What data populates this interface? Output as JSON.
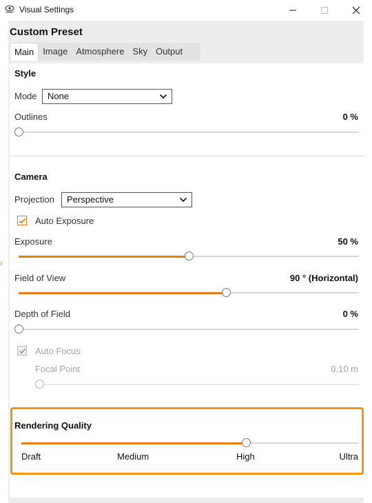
{
  "window": {
    "title": "Visual Settings"
  },
  "preset": {
    "title": "Custom Preset"
  },
  "tabs": [
    {
      "label": "Main",
      "active": true
    },
    {
      "label": "Image",
      "active": false
    },
    {
      "label": "Atmosphere",
      "active": false
    },
    {
      "label": "Sky",
      "active": false
    },
    {
      "label": "Output",
      "active": false
    }
  ],
  "style_section": {
    "title": "Style",
    "mode_label": "Mode",
    "mode_value": "None",
    "outlines_label": "Outlines",
    "outlines_value": "0 %",
    "outlines_fraction": 0.0
  },
  "camera_section": {
    "title": "Camera",
    "projection_label": "Projection",
    "projection_value": "Perspective",
    "auto_exposure_label": "Auto Exposure",
    "auto_exposure_checked": true,
    "exposure_label": "Exposure",
    "exposure_value": "50 %",
    "exposure_fraction": 0.5,
    "fov_label": "Field of View",
    "fov_value": "90 ° (Horizontal)",
    "fov_fraction": 0.61,
    "dof_label": "Depth of Field",
    "dof_value": "0 %",
    "dof_fraction": 0.0,
    "auto_focus_label": "Auto Focus",
    "auto_focus_checked": true,
    "focal_point_label": "Focal Point",
    "focal_point_value": "0.10 m",
    "focal_point_fraction": 0.0
  },
  "rendering_quality": {
    "title": "Rendering Quality",
    "level_fraction": 0.667,
    "labels": [
      "Draft",
      "Medium",
      "High",
      "Ultra"
    ]
  },
  "colors": {
    "accent": "#ee7d11",
    "highlight_border": "#f0960f"
  }
}
